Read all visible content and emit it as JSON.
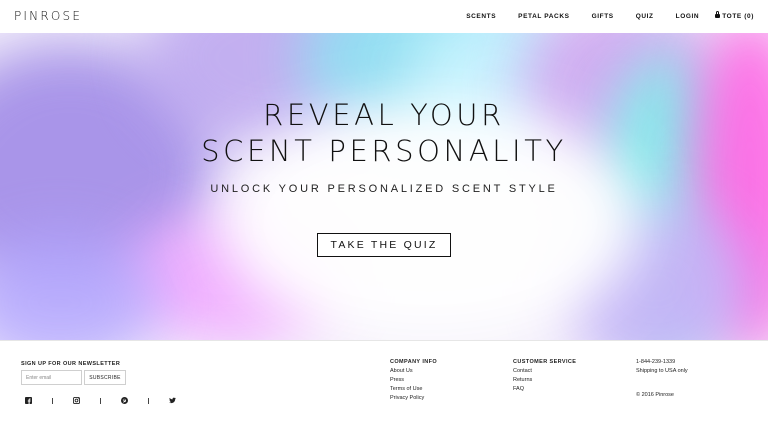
{
  "header": {
    "logo": "PINROSE",
    "nav": [
      {
        "label": "SCENTS"
      },
      {
        "label": "PETAL PACKS"
      },
      {
        "label": "GIFTS"
      },
      {
        "label": "QUIZ"
      },
      {
        "label": "LOGIN"
      },
      {
        "label": "TOTE (0)"
      }
    ]
  },
  "hero": {
    "title_line1": "REVEAL YOUR",
    "title_line2": "SCENT PERSONALITY",
    "subtitle": "UNLOCK YOUR PERSONALIZED SCENT STYLE",
    "cta": "TAKE THE QUIZ"
  },
  "footer": {
    "newsletter": {
      "label": "SIGN UP FOR OUR NEWSLETTER",
      "placeholder": "Enter email",
      "button": "SUBSCRIBE"
    },
    "social_icons": [
      "facebook-icon",
      "instagram-icon",
      "pinterest-icon",
      "twitter-icon"
    ],
    "company": {
      "heading": "COMPANY INFO",
      "links": [
        "About Us",
        "Press",
        "Terms of Use",
        "Privacy Policy"
      ]
    },
    "service": {
      "heading": "CUSTOMER SERVICE",
      "links": [
        "Contact",
        "Returns",
        "FAQ"
      ]
    },
    "contact": {
      "phone": "1-844-239-1339",
      "shipping": "Shipping to USA only",
      "copyright": "© 2016 Pinrose"
    }
  }
}
